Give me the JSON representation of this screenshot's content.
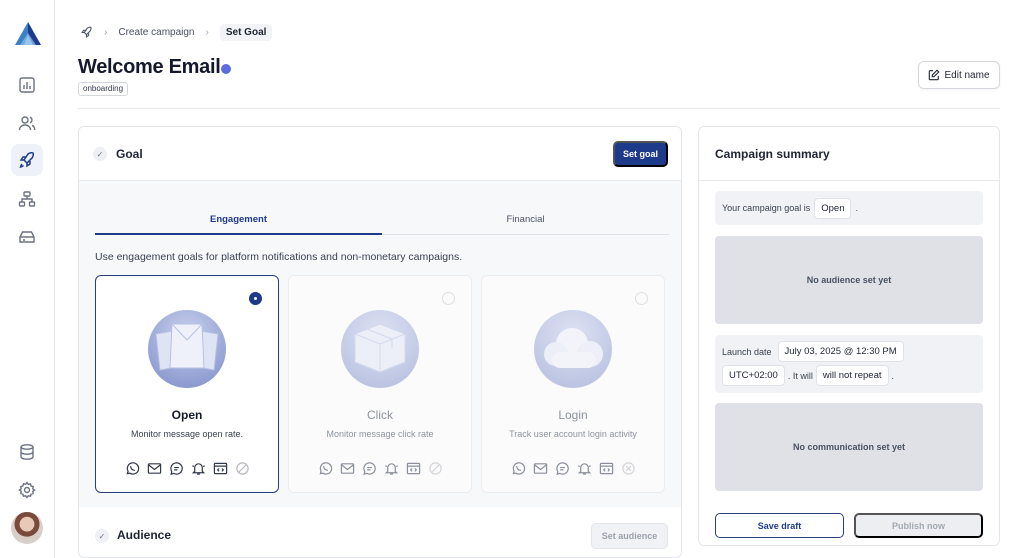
{
  "breadcrumb": {
    "step1": "Create campaign",
    "current": "Set Goal"
  },
  "header": {
    "title": "Welcome Email",
    "tag": "onboarding",
    "edit_label": "Edit name"
  },
  "goal": {
    "section_title": "Goal",
    "set_goal_label": "Set goal",
    "tabs": [
      {
        "label": "Engagement",
        "active": true
      },
      {
        "label": "Financial",
        "active": false
      }
    ],
    "description": "Use engagement goals for platform notifications and non-monetary campaigns.",
    "cards": [
      {
        "title": "Open",
        "subtitle": "Monitor message open rate.",
        "selected": true
      },
      {
        "title": "Click",
        "subtitle": "Monitor message click rate",
        "selected": false
      },
      {
        "title": "Login",
        "subtitle": "Track user account login activity",
        "selected": false
      }
    ],
    "channels": [
      "whatsapp-icon",
      "email-icon",
      "sms-icon",
      "push-notification-icon",
      "in-app-icon",
      "unavailable-icon"
    ]
  },
  "audience": {
    "section_title": "Audience",
    "set_label": "Set audience"
  },
  "summary": {
    "title": "Campaign summary",
    "goal_prefix": "Your campaign goal is",
    "goal_value": "Open",
    "goal_suffix": ".",
    "no_audience": "No audience set yet",
    "launch_label": "Launch date",
    "launch_value": "July 03, 2025 @ 12:30 PM",
    "timezone": "UTC+02:00",
    "repeat_prefix": ". It will",
    "repeat_value": "will not repeat",
    "repeat_suffix": ".",
    "no_communication": "No communication set yet",
    "save_label": "Save draft",
    "publish_label": "Publish now"
  },
  "colors": {
    "accent": "#1e3a8a",
    "status_dot": "#5d6de0"
  }
}
